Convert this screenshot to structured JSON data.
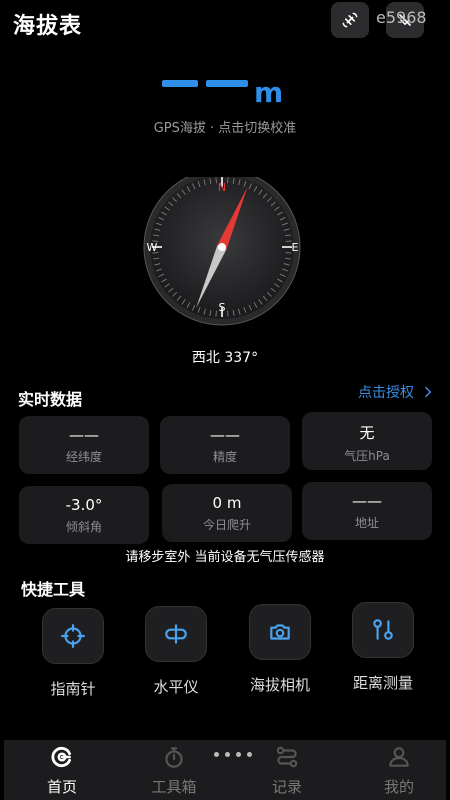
{
  "header": {
    "title": "海拔表",
    "code_text": "e5968",
    "icons": [
      "satellite-icon",
      "no-signal-icon"
    ]
  },
  "altitude": {
    "value": "——",
    "unit": "m",
    "caption": "GPS海拔 · 点击切换校准"
  },
  "compass": {
    "north": "N",
    "south": "S",
    "east": "E",
    "west": "W",
    "heading_degrees": 337,
    "heading_text": "西北 337°"
  },
  "realtime": {
    "title": "实时数据",
    "authorize_label": "点击授权",
    "tiles": [
      {
        "value": "——",
        "label": "经纬度"
      },
      {
        "value": "——",
        "label": "精度"
      },
      {
        "value": "无",
        "label": "气压hPa"
      },
      {
        "value": "-3.0°",
        "label": "倾斜角"
      },
      {
        "value": "0 m",
        "label": "今日爬升"
      },
      {
        "value": "——",
        "label": "地址"
      }
    ],
    "warning": "请移步室外 当前设备无气压传感器"
  },
  "tools": {
    "title": "快捷工具",
    "items": [
      {
        "label": "指南针",
        "icon": "compass-target-icon"
      },
      {
        "label": "水平仪",
        "icon": "level-icon"
      },
      {
        "label": "海拔相机",
        "icon": "camera-icon"
      },
      {
        "label": "距离测量",
        "icon": "distance-icon"
      }
    ]
  },
  "nav": {
    "items": [
      {
        "label": "首页",
        "icon": "home-icon",
        "active": true
      },
      {
        "label": "工具箱",
        "icon": "stopwatch-icon",
        "active": false
      },
      {
        "label": "记录",
        "icon": "route-icon",
        "active": false
      },
      {
        "label": "我的",
        "icon": "user-icon",
        "active": false
      }
    ]
  },
  "colors": {
    "accent": "#2e8ee8",
    "background": "#000000",
    "tile": "#1c1c1e",
    "needle_north": "#e53935"
  }
}
